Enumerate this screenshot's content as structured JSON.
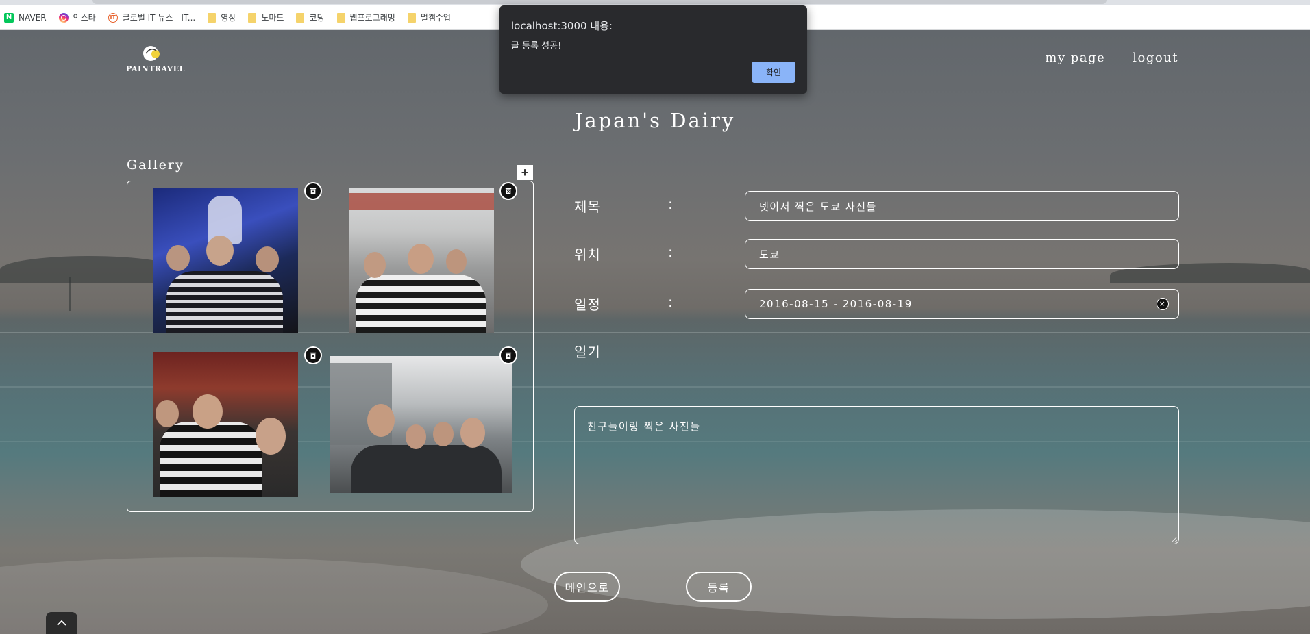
{
  "bookmarks": [
    {
      "label": "NAVER",
      "icon": "naver-icon"
    },
    {
      "label": "인스타",
      "icon": "instagram-icon"
    },
    {
      "label": "글로벌 IT 뉴스 - IT...",
      "icon": "it-news-icon"
    },
    {
      "label": "영상",
      "icon": "folder-icon"
    },
    {
      "label": "노마드",
      "icon": "folder-icon"
    },
    {
      "label": "코딩",
      "icon": "folder-icon"
    },
    {
      "label": "웹프로그래밍",
      "icon": "folder-icon"
    },
    {
      "label": "멀캠수업",
      "icon": "folder-icon"
    }
  ],
  "nav": {
    "logo_text": "PAINTRAVEL",
    "links": [
      "my page",
      "logout"
    ]
  },
  "page": {
    "title": "Japan's Dairy"
  },
  "gallery": {
    "label": "Gallery",
    "add_label": "+",
    "photo_count": 4
  },
  "form": {
    "title_label": "제목",
    "title_value": "넷이서 찍은 도쿄 사진들",
    "location_label": "위치",
    "location_value": "도쿄",
    "schedule_label": "일정",
    "schedule_value": "2016-08-15 - 2016-08-19",
    "clear_label": "×",
    "diary_label": "일기",
    "diary_value": "친구들이랑 찍은 사진들",
    "colon": ":"
  },
  "buttons": {
    "main": "메인으로",
    "submit": "등록"
  },
  "dialog": {
    "title": "localhost:3000 내용:",
    "message": "글 등록 성공!",
    "ok": "확인"
  },
  "colors": {
    "dialog_bg": "#292a2d",
    "dialog_button": "#8ab4f8",
    "text": "#ffffff"
  }
}
